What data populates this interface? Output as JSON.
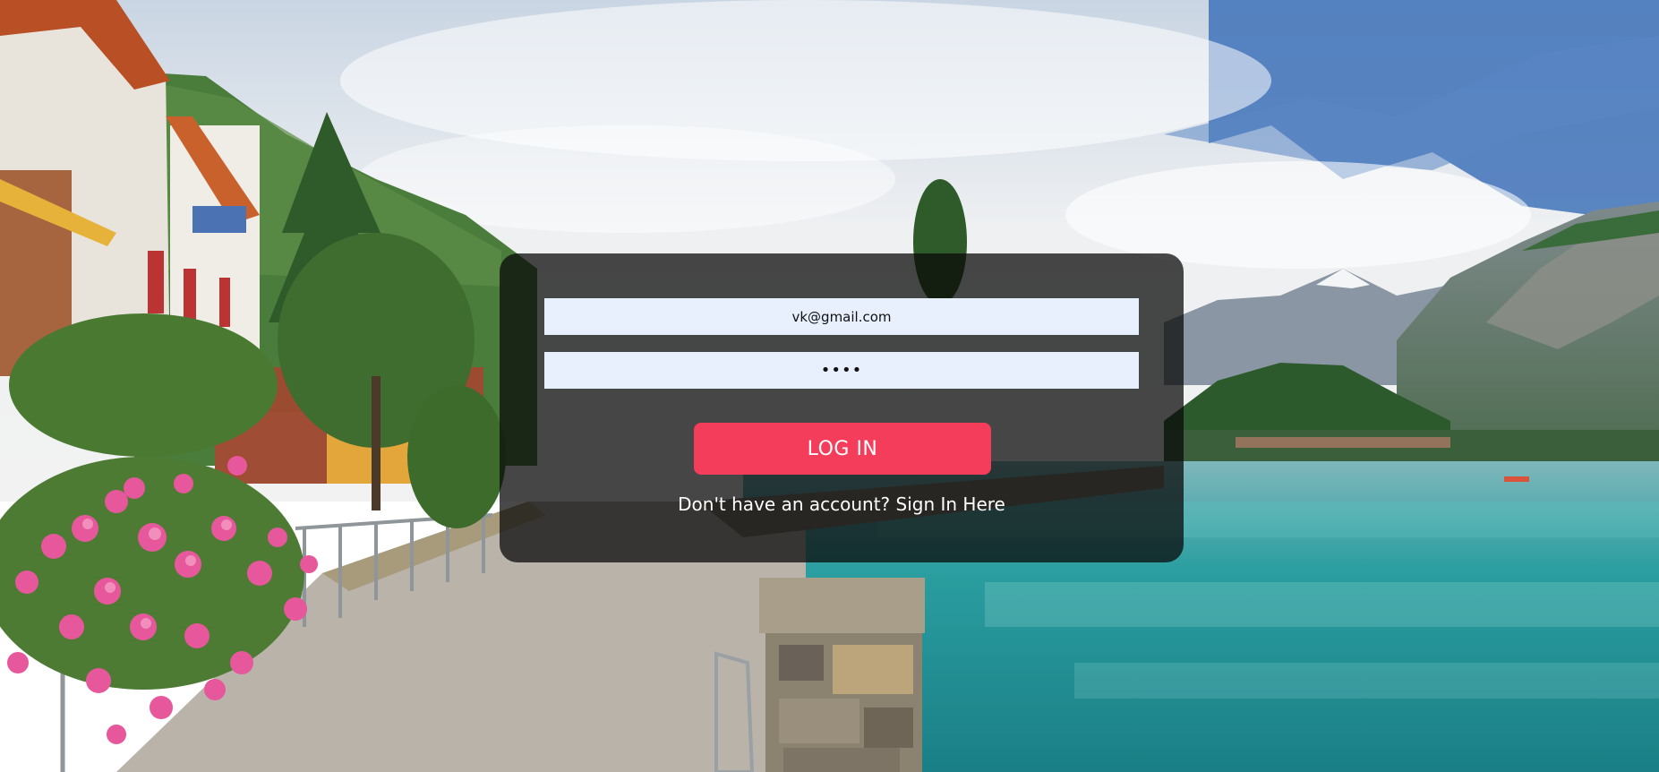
{
  "form": {
    "email_value": "vk@gmail.com",
    "password_value": "1234",
    "login_label": "LOG IN",
    "signup_prompt": "Don't have an account?",
    "signup_link": "Sign In Here"
  },
  "colors": {
    "button": "#f43c5b",
    "input_bg": "#e8f0fe",
    "card_bg": "rgba(10,10,10,0.74)"
  }
}
